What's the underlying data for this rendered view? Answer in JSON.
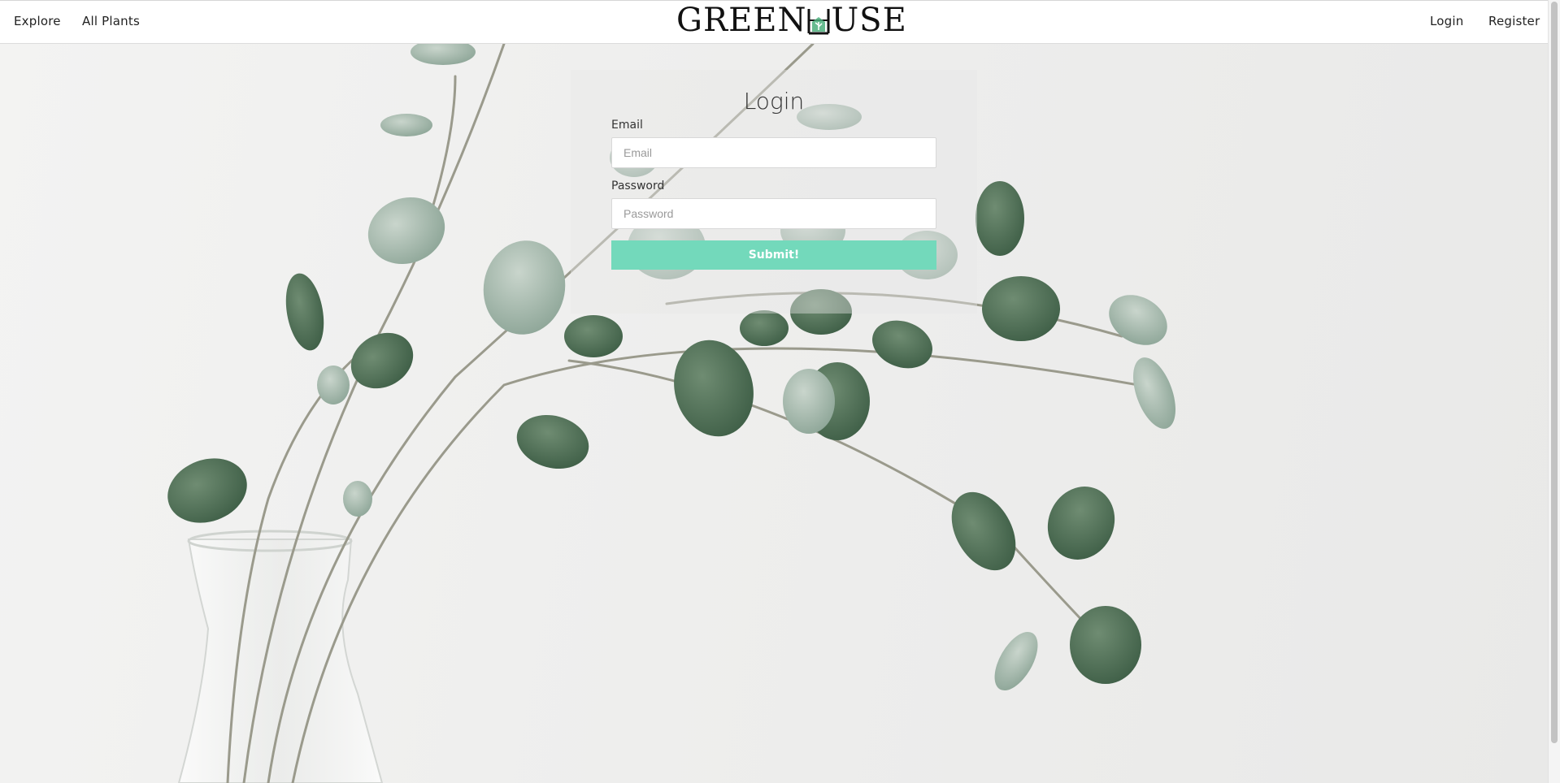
{
  "nav": {
    "left": [
      {
        "label": "Explore"
      },
      {
        "label": "All Plants"
      }
    ],
    "right": [
      {
        "label": "Login"
      },
      {
        "label": "Register"
      }
    ],
    "logo": {
      "pre": "GREEN",
      "post": "USE"
    }
  },
  "login": {
    "title": "Login",
    "email_label": "Email",
    "email_placeholder": "Email",
    "email_value": "",
    "password_label": "Password",
    "password_placeholder": "Password",
    "password_value": "",
    "submit_label": "Submit!"
  },
  "colors": {
    "accent": "#73d9bb",
    "leaf_dark": "#4f6e55",
    "leaf_light": "#9fb6a6"
  }
}
